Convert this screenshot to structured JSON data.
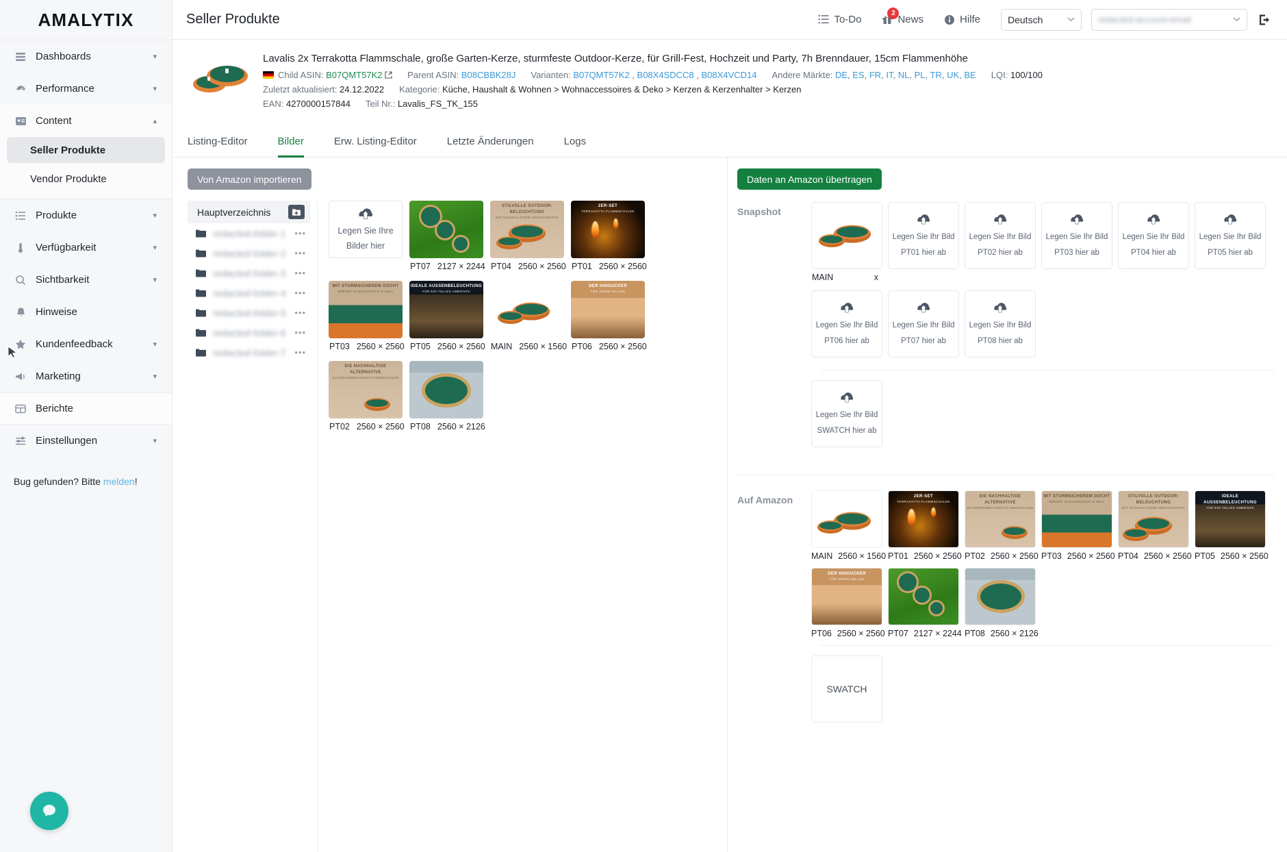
{
  "brand": "AMALYTIX",
  "sidebar": {
    "groups": [
      {
        "icon": "dashboard-icon",
        "label": "Dashboards",
        "chevron": "down"
      },
      {
        "icon": "gauge-icon",
        "label": "Performance",
        "chevron": "down"
      },
      {
        "icon": "content-icon",
        "label": "Content",
        "chevron": "up"
      }
    ],
    "sub_items": [
      {
        "label": "Seller Produkte",
        "selected": true
      },
      {
        "label": "Vendor Produkte",
        "selected": false
      }
    ],
    "lower_items": [
      {
        "icon": "list-icon",
        "label": "Produkte",
        "chevron": "down"
      },
      {
        "icon": "thermometer-icon",
        "label": "Verfügbarkeit",
        "chevron": "down"
      },
      {
        "icon": "search-icon",
        "label": "Sichtbarkeit",
        "chevron": "down"
      },
      {
        "icon": "bell-icon",
        "label": "Hinweise",
        "chevron": ""
      },
      {
        "icon": "star-icon",
        "label": "Kundenfeedback",
        "chevron": "down"
      },
      {
        "icon": "megaphone-icon",
        "label": "Marketing",
        "chevron": "down"
      },
      {
        "icon": "table-icon",
        "label": "Berichte",
        "chevron": ""
      },
      {
        "icon": "sliders-icon",
        "label": "Einstellungen",
        "chevron": "down"
      }
    ],
    "bug_prefix": "Bug gefunden? Bitte ",
    "bug_link": "melden",
    "bug_suffix": "!"
  },
  "topbar": {
    "page_title": "Seller Produkte",
    "todo_label": "To-Do",
    "news_label": "News",
    "news_badge": "2",
    "help_label": "Hilfe",
    "language": "Deutsch",
    "account_value": "redacted-account-email"
  },
  "product": {
    "title": "Lavalis 2x Terrakotta Flammschale, große Garten-Kerze, sturmfeste Outdoor-Kerze, für Grill-Fest, Hochzeit und Party, 7h Brenndauer, 15cm Flammenhöhe",
    "child_asin_label": "Child ASIN:",
    "child_asin": "B07QMT57K2",
    "parent_asin_label": "Parent ASIN:",
    "parent_asin": "B08CBBK28J",
    "variants_label": "Varianten:",
    "variants": [
      "B07QMT57K2",
      "B08X4SDCC8",
      "B08X4VCD14"
    ],
    "markets_label": "Andere Märkte:",
    "markets": [
      "DE",
      "ES",
      "FR",
      "IT",
      "NL",
      "PL",
      "TR",
      "UK",
      "BE"
    ],
    "lqi_label": "LQI:",
    "lqi_value": "100/100",
    "updated_label": "Zuletzt aktualisiert:",
    "updated_value": "24.12.2022",
    "category_label": "Kategorie:",
    "category_value": "Küche, Haushalt & Wohnen > Wohnaccessoires & Deko > Kerzen & Kerzenhalter > Kerzen",
    "ean_label": "EAN:",
    "ean_value": "4270000157844",
    "partno_label": "Teil Nr.:",
    "partno_value": "Lavalis_FS_TK_155"
  },
  "tabs": [
    {
      "label": "Listing-Editor",
      "selected": false
    },
    {
      "label": "Bilder",
      "selected": true
    },
    {
      "label": "Erw. Listing-Editor",
      "selected": false
    },
    {
      "label": "Letzte Änderungen",
      "selected": false
    },
    {
      "label": "Logs",
      "selected": false
    }
  ],
  "actions": {
    "import_label": "Von Amazon importieren",
    "transfer_label": "Daten an Amazon übertragen"
  },
  "folders": {
    "root_label": "Hauptverzeichnis",
    "add_icon": "add-folder-icon",
    "items": [
      {
        "name": "redacted-folder-1"
      },
      {
        "name": "redacted-folder-2"
      },
      {
        "name": "redacted-folder-3"
      },
      {
        "name": "redacted-folder-4"
      },
      {
        "name": "redacted-folder-5"
      },
      {
        "name": "redacted-folder-6"
      },
      {
        "name": "redacted-folder-7"
      }
    ]
  },
  "gallery": {
    "dropzone_line1": "Legen Sie Ihre",
    "dropzone_line2": "Bilder hier",
    "items": [
      {
        "name": "PT07",
        "size": "2127 × 2244",
        "style": "grass"
      },
      {
        "name": "PT04",
        "size": "2560 × 2560",
        "style": "beige",
        "overlay": "STILVOLLE OUTDOOR-BELEUCHTUNG",
        "overlay_sub": "MIT NACHHALTIGEM VERSCHWATCH"
      },
      {
        "name": "PT01",
        "size": "2560 × 2560",
        "style": "darkset",
        "overlay": "2ER-SET",
        "overlay_sub": "TERRAKOTTA-FLAMMSCHALEN"
      },
      {
        "name": "PT03",
        "size": "2560 × 2560",
        "style": "green-board",
        "overlay": "MIT STURMSICHEREM DOCHT",
        "overlay_sub": "BRENNT GLEICHMÄSSIG & HELL"
      },
      {
        "name": "PT05",
        "size": "2560 × 2560",
        "style": "party",
        "overlay": "IDEALE AUSSENBELEUCHTUNG",
        "overlay_sub": "FÜR EIN TOLLES AMBIENTE"
      },
      {
        "name": "MAIN",
        "size": "2560 × 1560",
        "style": "bowl-white"
      },
      {
        "name": "PT06",
        "size": "2560 × 2560",
        "style": "sunset",
        "overlay": "DER HINGUCKER",
        "overlay_sub": "FÜR JEDEN ANLASS"
      },
      {
        "name": "PT02",
        "size": "2560 × 2560",
        "style": "beige",
        "overlay": "DIE NACHHALTIGE ALTERNATIVE",
        "overlay_sub": "ZU HERKÖMMLICHEN FLAMMSCHALEN"
      },
      {
        "name": "PT08",
        "size": "2560 × 2126",
        "style": "teal-dish"
      }
    ]
  },
  "snapshot": {
    "label": "Snapshot",
    "drop_prefix": "Legen Sie Ihr Bild",
    "drop_suffix": "hier ab",
    "main_slot": {
      "name": "MAIN",
      "remove": "x"
    },
    "empty_slots": [
      "PT01",
      "PT02",
      "PT03",
      "PT04",
      "PT05",
      "PT06",
      "PT07",
      "PT08"
    ],
    "swatch_slot": "SWATCH"
  },
  "amazon": {
    "label": "Auf Amazon",
    "items": [
      {
        "name": "MAIN",
        "size": "2560 × 1560",
        "style": "bowl-white"
      },
      {
        "name": "PT01",
        "size": "2560 × 2560",
        "style": "darkset",
        "overlay": "2ER-SET",
        "overlay_sub": "TERRAKOTTA-FLAMMSCHALEN"
      },
      {
        "name": "PT02",
        "size": "2560 × 2560",
        "style": "beige",
        "overlay": "DIE NACHHALTIGE ALTERNATIVE",
        "overlay_sub": "ZU HERKÖMMLICHEN FLAMMSCHALEN"
      },
      {
        "name": "PT03",
        "size": "2560 × 2560",
        "style": "green-board",
        "overlay": "MIT STURMSICHEREM DOCHT",
        "overlay_sub": "BRENNT GLEICHMÄSSIG & HELL"
      },
      {
        "name": "PT04",
        "size": "2560 × 2560",
        "style": "beige",
        "overlay": "STILVOLLE OUTDOOR-BELEUCHTUNG",
        "overlay_sub": "MIT NACHHALTIGEM VERSCHWATCH"
      },
      {
        "name": "PT05",
        "size": "2560 × 2560",
        "style": "party",
        "overlay": "IDEALE AUSSENBELEUCHTUNG",
        "overlay_sub": "FÜR EIN TOLLES AMBIENTE"
      },
      {
        "name": "PT06",
        "size": "2560 × 2560",
        "style": "sunset",
        "overlay": "DER HINGUCKER",
        "overlay_sub": "FÜR JEDEN ANLASS"
      },
      {
        "name": "PT07",
        "size": "2127 × 2244",
        "style": "grass"
      },
      {
        "name": "PT08",
        "size": "2560 × 2126",
        "style": "teal-dish"
      }
    ],
    "swatch_label": "SWATCH"
  },
  "colors": {
    "accent_green": "#13803f",
    "link_blue": "#3a9ad9",
    "badge_red": "#e8373c",
    "help_teal": "#1fb6a6"
  }
}
